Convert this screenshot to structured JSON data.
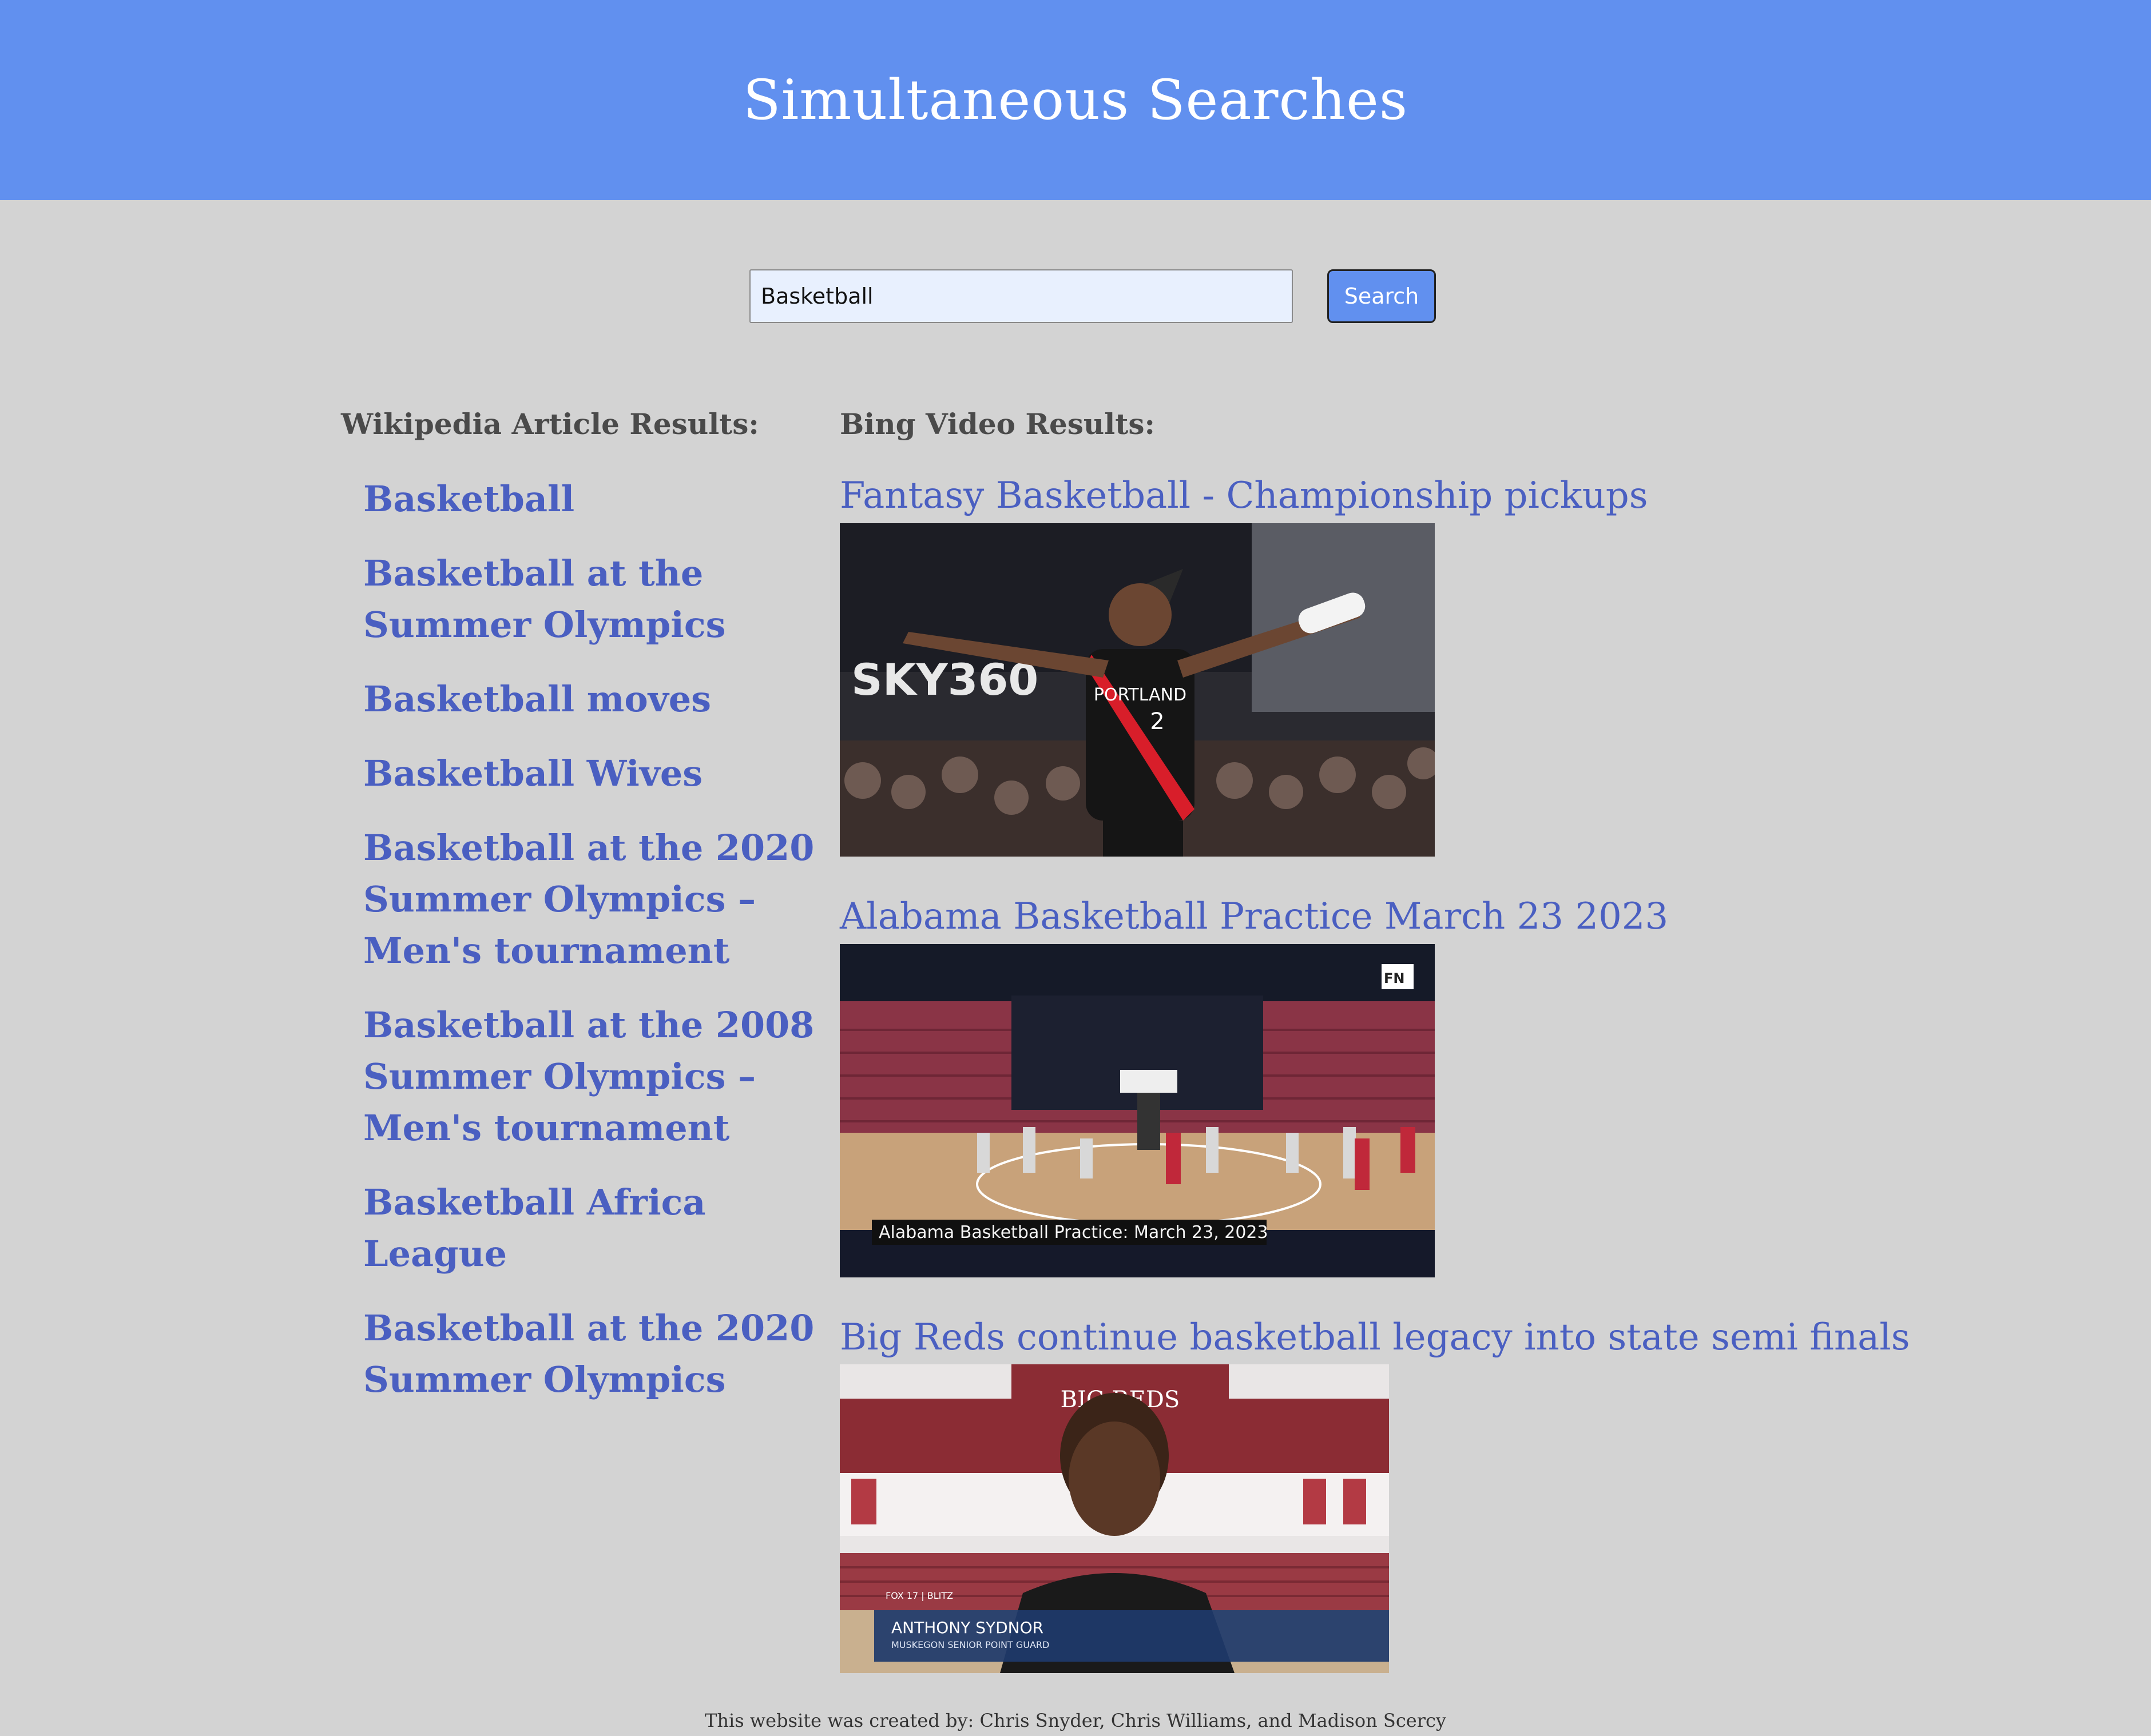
{
  "header": {
    "title": "Simultaneous Searches"
  },
  "search": {
    "value": "Basketball",
    "button_label": "Search"
  },
  "wikipedia": {
    "heading": "Wikipedia Article Results:",
    "results": [
      "Basketball",
      "Basketball at the Summer Olympics",
      "Basketball moves",
      "Basketball Wives",
      "Basketball at the 2020 Summer Olympics – Men's tournament",
      "Basketball at the 2008 Summer Olympics – Men's tournament",
      "Basketball Africa League",
      "Basketball at the 2020 Summer Olympics"
    ]
  },
  "bing": {
    "heading": "Bing Video Results:",
    "videos": [
      {
        "title": "Fantasy Basketball - Championship pickups",
        "thumb_text": [
          "SKY360",
          "PORTLAND",
          "2"
        ]
      },
      {
        "title": "Alabama Basketball Practice March 23 2023",
        "thumb_text": [
          "Alabama Basketball Practice: March 23, 2023",
          "FN"
        ]
      },
      {
        "title": "Big Reds continue basketball legacy into state semi finals",
        "thumb_text": [
          "BIG REDS",
          "ANTHONY SYDNOR",
          "MUSKEGON SENIOR POINT GUARD",
          "FOX 17 | BLITZ"
        ]
      }
    ]
  },
  "footer": {
    "text": "This website was created by: Chris Snyder, Chris Williams, and Madison Scercy"
  },
  "colors": {
    "header_bg": "#6190ef",
    "page_bg": "#d3d3d3",
    "link": "#4a5fc1",
    "input_bg": "#e8f0fe"
  }
}
